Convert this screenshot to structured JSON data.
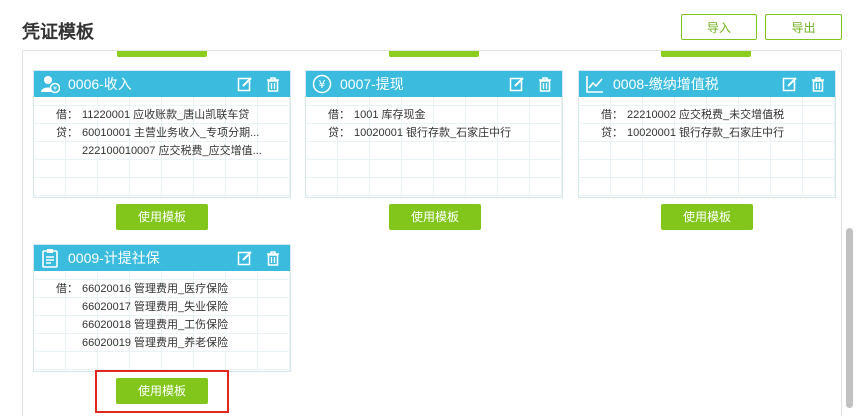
{
  "page": {
    "title": "凭证模板",
    "import_label": "导入",
    "export_label": "导出"
  },
  "colors": {
    "header_bg": "#3bbcdf",
    "accent_green": "#82c61c",
    "highlight_red": "#e0281e"
  },
  "cards": [
    {
      "title": "0006-收入",
      "icon": "people-money-icon",
      "lines": [
        {
          "tag": "借：",
          "text": "11220001 应收账款_唐山凯联车贷"
        },
        {
          "tag": "贷：",
          "text": "60010001 主营业务收入_专项分期..."
        },
        {
          "tag": "",
          "text": "222100010007 应交税费_应交增值..."
        }
      ],
      "button_label": "使用模板"
    },
    {
      "title": "0007-提现",
      "icon": "yen-coin-icon",
      "lines": [
        {
          "tag": "借：",
          "text": "1001 库存现金"
        },
        {
          "tag": "贷：",
          "text": "10020001 银行存款_石家庄中行"
        }
      ],
      "button_label": "使用模板"
    },
    {
      "title": "0008-缴纳增值税",
      "icon": "trend-chart-icon",
      "lines": [
        {
          "tag": "借：",
          "text": "22210002 应交税费_未交增值税"
        },
        {
          "tag": "贷：",
          "text": "10020001 银行存款_石家庄中行"
        }
      ],
      "button_label": "使用模板"
    },
    {
      "title": "0009-计提社保",
      "icon": "clipboard-icon",
      "lines": [
        {
          "tag": "借：",
          "text": "66020016 管理费用_医疗保险"
        },
        {
          "tag": "",
          "text": "66020017 管理费用_失业保险"
        },
        {
          "tag": "",
          "text": "66020018 管理费用_工伤保险"
        },
        {
          "tag": "",
          "text": "66020019 管理费用_养老保险"
        }
      ],
      "button_label": "使用模板"
    }
  ]
}
